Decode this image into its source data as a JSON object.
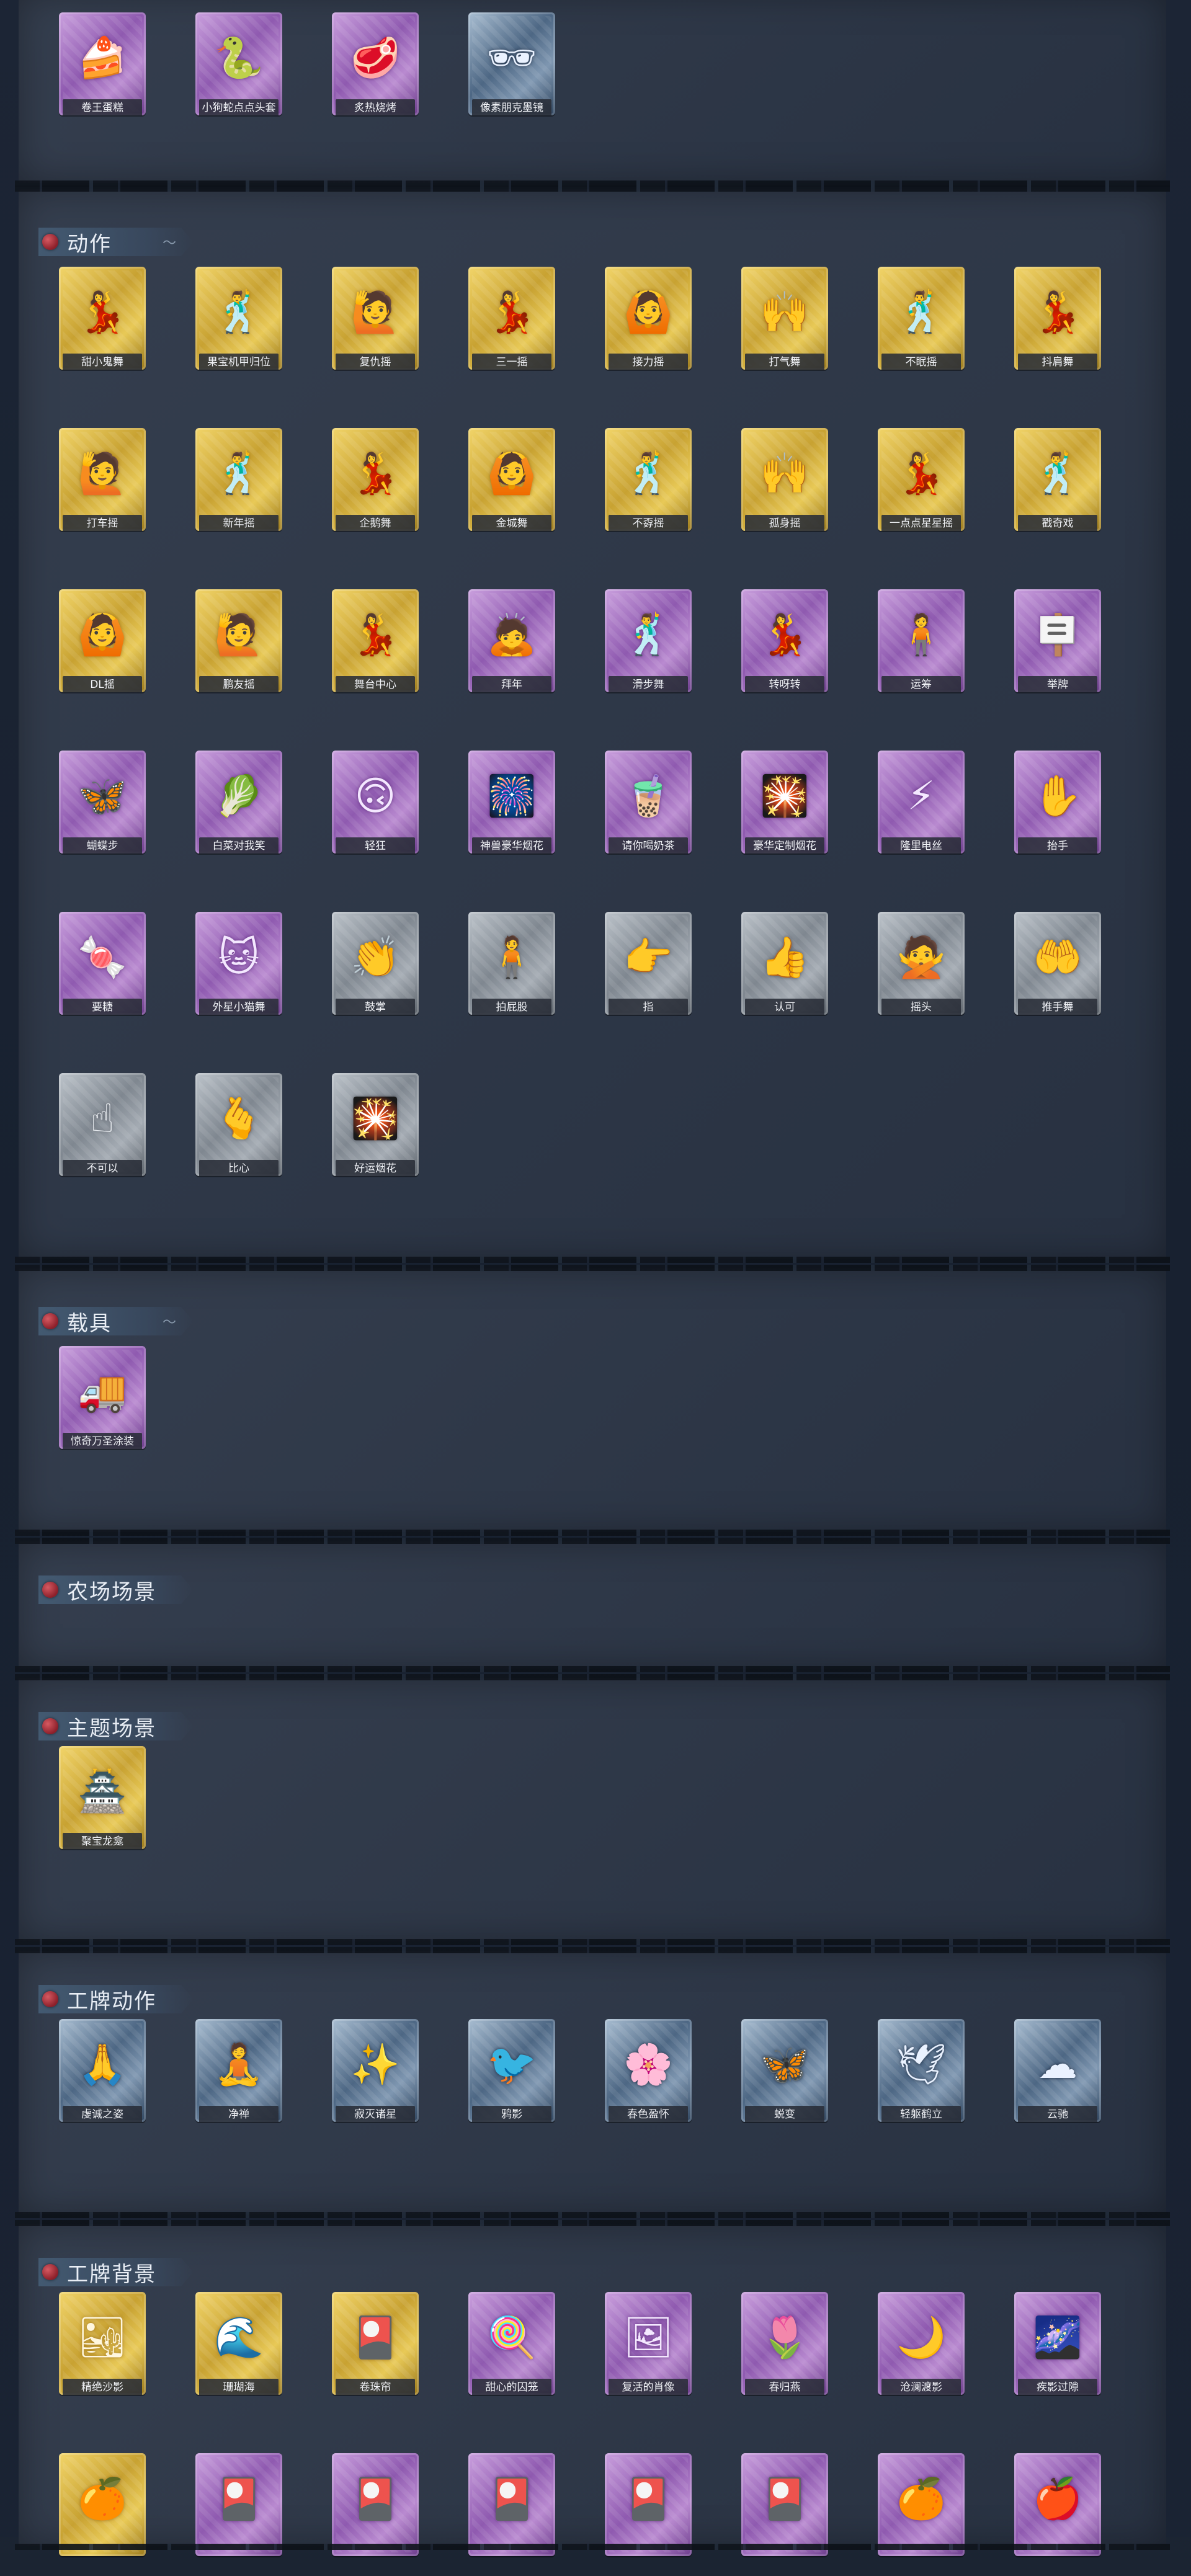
{
  "sections": [
    {
      "id": "top",
      "title": "",
      "items": [
        {
          "label": "卷王蛋糕",
          "frame": "purple",
          "icon": "cake-icon",
          "glyph": "🍰"
        },
        {
          "label": "小狗蛇点点头套",
          "frame": "purple",
          "icon": "snake-head-icon",
          "glyph": "🐍"
        },
        {
          "label": "炙热烧烤",
          "frame": "purple",
          "icon": "grill-box-icon",
          "glyph": "🥩"
        },
        {
          "label": "像素朋克墨镜",
          "frame": "blue",
          "icon": "pixel-sunglasses-icon",
          "glyph": "🕶"
        }
      ]
    },
    {
      "id": "actions",
      "title": "动作",
      "items": [
        {
          "label": "甜小鬼舞",
          "frame": "gold",
          "icon": "dance-pose-icon",
          "glyph": "💃"
        },
        {
          "label": "果宝机甲归位",
          "frame": "gold",
          "icon": "dance-pose-icon",
          "glyph": "🕺"
        },
        {
          "label": "复仇摇",
          "frame": "gold",
          "icon": "dance-pose-icon",
          "glyph": "🙋"
        },
        {
          "label": "三一摇",
          "frame": "gold",
          "icon": "dance-pose-icon",
          "glyph": "💃"
        },
        {
          "label": "接力摇",
          "frame": "gold",
          "icon": "dance-pose-icon",
          "glyph": "🙆"
        },
        {
          "label": "打气舞",
          "frame": "gold",
          "icon": "dance-pose-icon",
          "glyph": "🙌"
        },
        {
          "label": "不眠摇",
          "frame": "gold",
          "icon": "dance-pose-icon",
          "glyph": "🕺"
        },
        {
          "label": "抖肩舞",
          "frame": "gold",
          "icon": "dance-pose-icon",
          "glyph": "💃"
        },
        {
          "label": "打车摇",
          "frame": "gold",
          "icon": "dance-pose-icon",
          "glyph": "🙋"
        },
        {
          "label": "新年摇",
          "frame": "gold",
          "icon": "dance-pose-icon",
          "glyph": "🕺"
        },
        {
          "label": "企鹅舞",
          "frame": "gold",
          "icon": "dance-pose-icon",
          "glyph": "💃"
        },
        {
          "label": "金城舞",
          "frame": "gold",
          "icon": "dance-pose-icon",
          "glyph": "🙆"
        },
        {
          "label": "不孬摇",
          "frame": "gold",
          "icon": "dance-pose-icon",
          "glyph": "🕺"
        },
        {
          "label": "孤身摇",
          "frame": "gold",
          "icon": "dance-pose-icon",
          "glyph": "🙌"
        },
        {
          "label": "一点点星星摇",
          "frame": "gold",
          "icon": "dance-pose-icon",
          "glyph": "💃"
        },
        {
          "label": "戳奇戏",
          "frame": "gold",
          "icon": "dance-pose-icon",
          "glyph": "🕺"
        },
        {
          "label": "DL摇",
          "frame": "gold",
          "icon": "dance-pose-icon",
          "glyph": "🙆"
        },
        {
          "label": "鹏友摇",
          "frame": "gold",
          "icon": "dance-pose-icon",
          "glyph": "🙋"
        },
        {
          "label": "舞台中心",
          "frame": "gold",
          "icon": "dance-pose-icon",
          "glyph": "💃"
        },
        {
          "label": "拜年",
          "frame": "purple",
          "icon": "bow-pose-icon",
          "glyph": "🙇"
        },
        {
          "label": "滑步舞",
          "frame": "purple",
          "icon": "slide-dance-icon",
          "glyph": "🕺"
        },
        {
          "label": "转呀转",
          "frame": "purple",
          "icon": "spin-dance-icon",
          "glyph": "💃"
        },
        {
          "label": "运筹",
          "frame": "purple",
          "icon": "strategy-pose-icon",
          "glyph": "🧍"
        },
        {
          "label": "举牌",
          "frame": "purple",
          "icon": "sign-hold-icon",
          "glyph": "🪧"
        },
        {
          "label": "蝴蝶步",
          "frame": "purple",
          "icon": "butterfly-step-icon",
          "glyph": "🦋"
        },
        {
          "label": "白菜对我笑",
          "frame": "purple",
          "icon": "cabbage-pose-icon",
          "glyph": "🥬"
        },
        {
          "label": "轻狂",
          "frame": "purple",
          "icon": "wild-pose-icon",
          "glyph": "🙃"
        },
        {
          "label": "神兽豪华烟花",
          "frame": "purple",
          "icon": "fireworks-icon",
          "glyph": "🎆"
        },
        {
          "label": "请你喝奶茶",
          "frame": "purple",
          "icon": "milk-tea-icon",
          "glyph": "🧋"
        },
        {
          "label": "豪华定制烟花",
          "frame": "purple",
          "icon": "fireworks-icon",
          "glyph": "🎇"
        },
        {
          "label": "隆里电丝",
          "frame": "purple",
          "icon": "electric-dance-icon",
          "glyph": "⚡"
        },
        {
          "label": "抬手",
          "frame": "purple",
          "icon": "raise-hand-icon",
          "glyph": "✋"
        },
        {
          "label": "要糖",
          "frame": "purple",
          "icon": "ask-candy-icon",
          "glyph": "🍬"
        },
        {
          "label": "外星小猫舞",
          "frame": "purple",
          "icon": "alien-cat-dance-icon",
          "glyph": "🐱"
        },
        {
          "label": "鼓掌",
          "frame": "silver",
          "icon": "clap-icon",
          "glyph": "👏"
        },
        {
          "label": "拍屁股",
          "frame": "silver",
          "icon": "pat-pose-icon",
          "glyph": "🧍"
        },
        {
          "label": "指",
          "frame": "silver",
          "icon": "point-icon",
          "glyph": "👉"
        },
        {
          "label": "认可",
          "frame": "silver",
          "icon": "thumbs-up-icon",
          "glyph": "👍"
        },
        {
          "label": "摇头",
          "frame": "silver",
          "icon": "shake-head-icon",
          "glyph": "🙅"
        },
        {
          "label": "推手舞",
          "frame": "silver",
          "icon": "push-hand-icon",
          "glyph": "🤲"
        },
        {
          "label": "不可以",
          "frame": "silver",
          "icon": "no-finger-icon",
          "glyph": "☝"
        },
        {
          "label": "比心",
          "frame": "silver",
          "icon": "finger-heart-icon",
          "glyph": "🫰"
        },
        {
          "label": "好运烟花",
          "frame": "silver",
          "icon": "lucky-firework-icon",
          "glyph": "🎇"
        }
      ]
    },
    {
      "id": "vehicles",
      "title": "载具",
      "items": [
        {
          "label": "惊奇万圣涂装",
          "frame": "purple",
          "icon": "halloween-truck-icon",
          "glyph": "🚚"
        }
      ]
    },
    {
      "id": "farm-scenes",
      "title": "农场场景",
      "items": []
    },
    {
      "id": "theme-scenes",
      "title": "主题场景",
      "items": [
        {
          "label": "聚宝龙龛",
          "frame": "gold",
          "icon": "dragon-shrine-icon",
          "glyph": "🏯"
        }
      ]
    },
    {
      "id": "badge-actions",
      "title": "工牌动作",
      "items": [
        {
          "label": "虔诚之姿",
          "frame": "blue",
          "icon": "pose-silhouette-icon",
          "glyph": "🙏"
        },
        {
          "label": "净禅",
          "frame": "blue",
          "icon": "pose-silhouette-icon",
          "glyph": "🧘"
        },
        {
          "label": "寂灭诸星",
          "frame": "blue",
          "icon": "pose-silhouette-icon",
          "glyph": "✨"
        },
        {
          "label": "鸦影",
          "frame": "blue",
          "icon": "pose-silhouette-icon",
          "glyph": "🐦"
        },
        {
          "label": "春色盈怀",
          "frame": "blue",
          "icon": "pose-silhouette-icon",
          "glyph": "🌸"
        },
        {
          "label": "蜕变",
          "frame": "blue",
          "icon": "pose-silhouette-icon",
          "glyph": "🦋"
        },
        {
          "label": "轻躯鹤立",
          "frame": "blue",
          "icon": "pose-silhouette-icon",
          "glyph": "🕊"
        },
        {
          "label": "云驰",
          "frame": "blue",
          "icon": "pose-silhouette-icon",
          "glyph": "☁"
        }
      ]
    },
    {
      "id": "badge-backgrounds",
      "title": "工牌背景",
      "items": [
        {
          "label": "精绝沙影",
          "frame": "gold",
          "icon": "desert-card-icon",
          "glyph": "🏜"
        },
        {
          "label": "珊瑚海",
          "frame": "gold",
          "icon": "coral-sea-card-icon",
          "glyph": "🌊"
        },
        {
          "label": "卷珠帘",
          "frame": "gold",
          "icon": "curtain-card-icon",
          "glyph": "🎴"
        },
        {
          "label": "甜心的囚笼",
          "frame": "purple",
          "icon": "sweet-cage-card-icon",
          "glyph": "🍭"
        },
        {
          "label": "复活的肖像",
          "frame": "purple",
          "icon": "portrait-card-icon",
          "glyph": "🖼"
        },
        {
          "label": "春归燕",
          "frame": "purple",
          "icon": "swallow-card-icon",
          "glyph": "🌷"
        },
        {
          "label": "沧澜渡影",
          "frame": "purple",
          "icon": "waves-card-icon",
          "glyph": "🌙"
        },
        {
          "label": "疾影过隙",
          "frame": "purple",
          "icon": "shadow-card-icon",
          "glyph": "🌌"
        },
        {
          "label": "",
          "frame": "gold",
          "icon": "fruit-card-icon",
          "glyph": "🍊"
        },
        {
          "label": "",
          "frame": "purple",
          "icon": "card-icon",
          "glyph": "🎴"
        },
        {
          "label": "",
          "frame": "purple",
          "icon": "card-icon",
          "glyph": "🎴"
        },
        {
          "label": "",
          "frame": "purple",
          "icon": "card-icon",
          "glyph": "🎴"
        },
        {
          "label": "",
          "frame": "purple",
          "icon": "card-icon",
          "glyph": "🎴"
        },
        {
          "label": "",
          "frame": "purple",
          "icon": "card-icon",
          "glyph": "🎴"
        },
        {
          "label": "",
          "frame": "purple",
          "icon": "card-icon",
          "glyph": "🍊"
        },
        {
          "label": "",
          "frame": "purple",
          "icon": "card-icon",
          "glyph": "🍎"
        }
      ]
    }
  ]
}
